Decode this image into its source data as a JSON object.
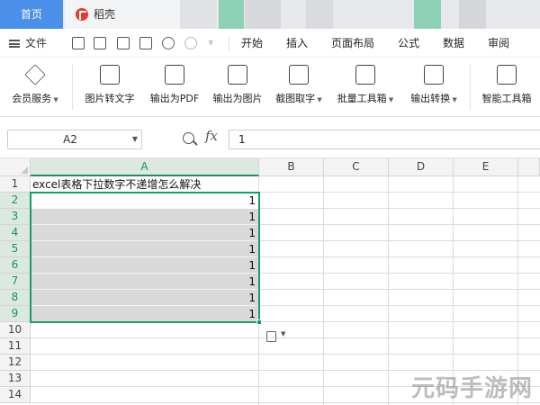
{
  "tabs": {
    "home": "首页",
    "document": "稻壳"
  },
  "menu": {
    "file": "文件",
    "tabs": [
      "开始",
      "插入",
      "页面布局",
      "公式",
      "数据",
      "审阅"
    ]
  },
  "ribbon": {
    "buttons": [
      {
        "label": "会员服务",
        "icon": "diamond-icon",
        "dropdown": true
      },
      {
        "label": "图片转文字",
        "icon": "image-to-text-icon",
        "dropdown": false
      },
      {
        "label": "输出为PDF",
        "icon": "pdf-export-icon",
        "dropdown": false
      },
      {
        "label": "输出为图片",
        "icon": "image-export-icon",
        "dropdown": false
      },
      {
        "label": "截图取字",
        "icon": "screenshot-ocr-icon",
        "dropdown": true
      },
      {
        "label": "批量工具箱",
        "icon": "toolbox-icon",
        "dropdown": true
      },
      {
        "label": "输出转换",
        "icon": "convert-icon",
        "dropdown": true
      },
      {
        "label": "智能工具箱",
        "icon": "smart-toolbox-icon",
        "dropdown": false
      }
    ]
  },
  "formula_bar": {
    "cell_ref": "A2",
    "value": "1"
  },
  "sheet": {
    "columns": [
      "A",
      "B",
      "C",
      "D",
      "E"
    ],
    "rows": [
      "1",
      "2",
      "3",
      "4",
      "5",
      "6",
      "7",
      "8",
      "9",
      "10",
      "11",
      "12",
      "13",
      "14"
    ],
    "a1_text": "excel表格下拉数字不递增怎么解决",
    "a2_to_a9": [
      "1",
      "1",
      "1",
      "1",
      "1",
      "1",
      "1",
      "1"
    ]
  },
  "watermark": "元码手游网",
  "colors": {
    "accent": "#1e9b62",
    "home_tab": "#4a8fe8",
    "logo": "#e33b2e"
  }
}
